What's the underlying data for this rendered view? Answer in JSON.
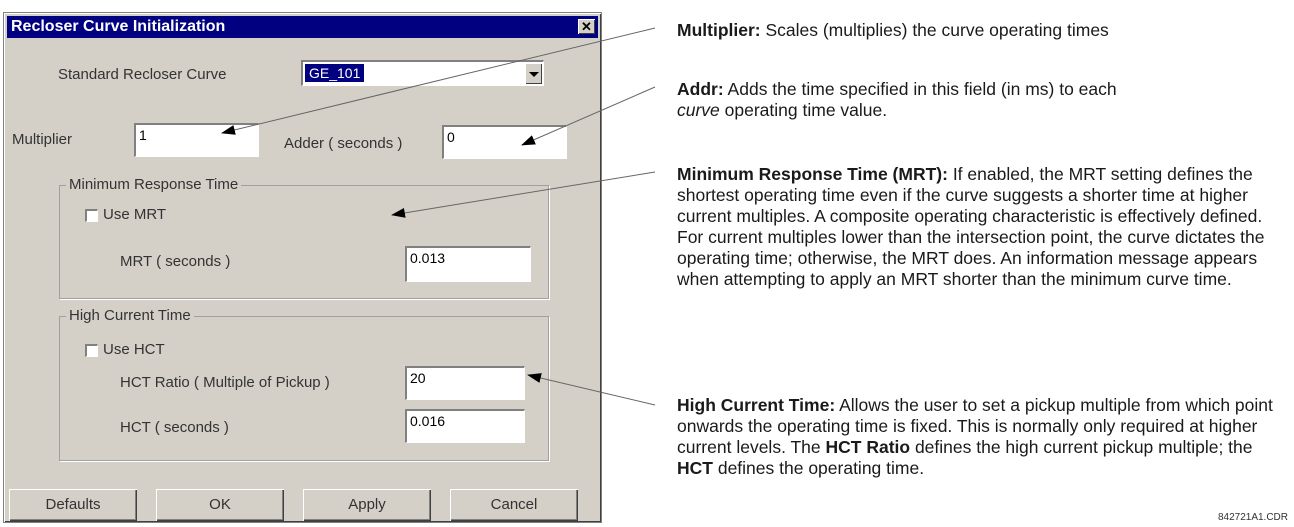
{
  "dialog": {
    "title": "Recloser Curve Initialization",
    "close_glyph": "✕",
    "standard_curve_label": "Standard Recloser Curve",
    "standard_curve_value": "GE_101",
    "multiplier_label": "Multiplier",
    "multiplier_value": "1",
    "adder_label": "Adder ( seconds )",
    "adder_value": "0",
    "mrt_group_title": "Minimum Response Time",
    "use_mrt_label": "Use MRT",
    "use_mrt_checked": false,
    "mrt_label": "MRT  ( seconds )",
    "mrt_value": "0.013",
    "hct_group_title": "High Current Time",
    "use_hct_label": "Use HCT",
    "use_hct_checked": false,
    "hct_ratio_label": "HCT Ratio  ( Multiple of Pickup )",
    "hct_ratio_value": "20",
    "hct_label": "HCT  ( seconds )",
    "hct_value": "0.016",
    "buttons": {
      "defaults": "Defaults",
      "ok": "OK",
      "apply": "Apply",
      "cancel": "Cancel"
    }
  },
  "annotations": {
    "multiplier": {
      "term": "Multiplier:",
      "text": " Scales (multiplies) the curve operating times"
    },
    "addr": {
      "term": "Addr:",
      "text1": " Adds the time specified in this field (in ms) to each",
      "text2_italic": "curve",
      "text3": " operating time value."
    },
    "mrt": {
      "term": "Minimum Response Time (MRT):",
      "text": " If enabled, the MRT setting defines the shortest operating time even if the curve suggests a shorter time at higher current multiples. A composite operating characteristic is effectively defined. For current multiples lower than the intersection point, the curve dictates the operating time; otherwise, the MRT does. An information message appears when attempting to apply an MRT shorter than the minimum curve time."
    },
    "hct": {
      "term": "High Current Time:",
      "text1": " Allows the user to set a pickup multiple from which point onwards the operating time is fixed. This is normally only required at higher current levels. The ",
      "term2": "HCT Ratio",
      "text2": " defines the high current pickup multiple; the ",
      "term3": "HCT",
      "text3": " defines the operating time."
    }
  },
  "figure_code": "842721A1.CDR"
}
